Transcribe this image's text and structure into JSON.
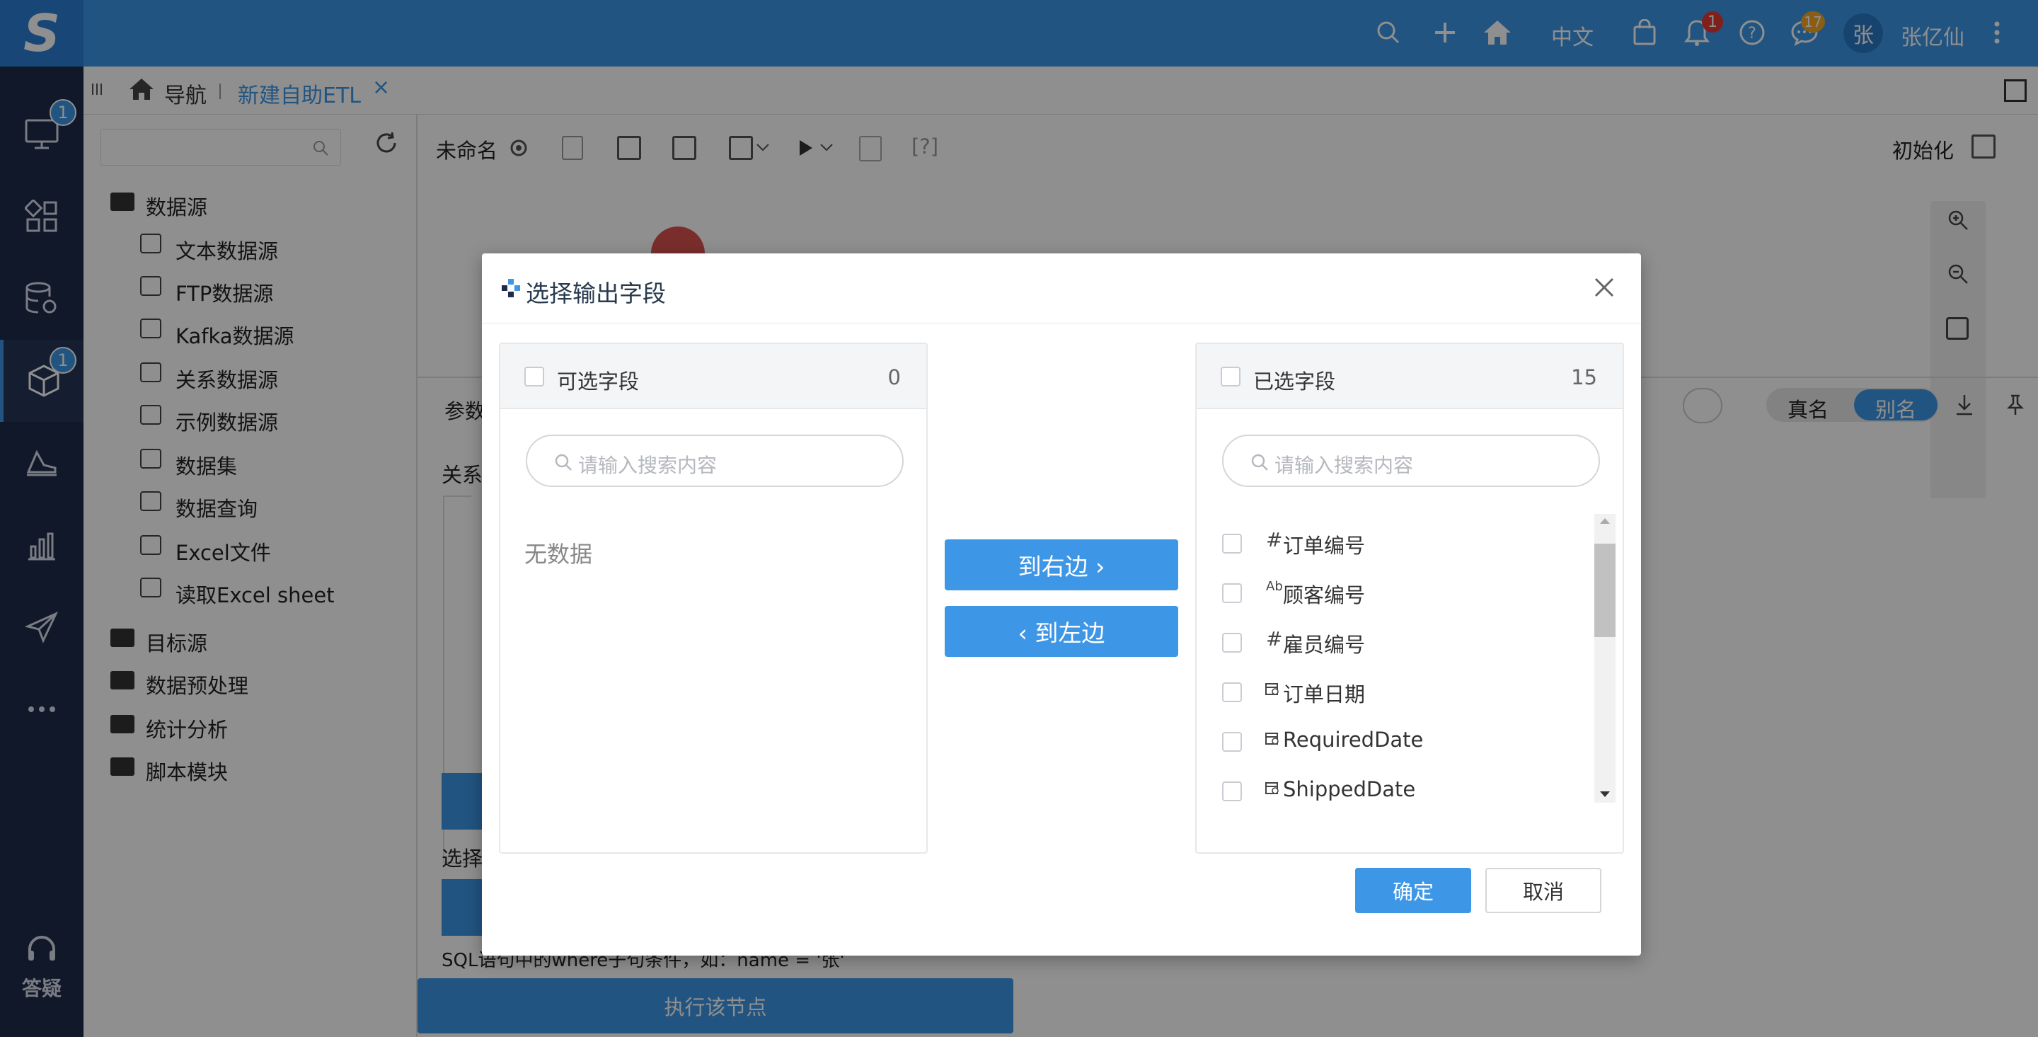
{
  "topbar": {
    "language": "中文",
    "notification_count": "1",
    "message_count": "17",
    "avatar_initial": "张",
    "user_name": "张亿仙"
  },
  "rail": {
    "badge_1": "1",
    "badge_2": "1",
    "help_label": "答疑"
  },
  "tabs": {
    "nav_label": "导航",
    "active_tab": "新建自助ETL",
    "close_symbol": "×"
  },
  "toolbar": {
    "unnamed": "未命名",
    "help": "[?]",
    "init": "初始化"
  },
  "tree": {
    "datasource": "数据源",
    "items": [
      "文本数据源",
      "FTP数据源",
      "Kafka数据源",
      "关系数据源",
      "示例数据源",
      "数据集",
      "数据查询",
      "Excel文件",
      "读取Excel sheet"
    ],
    "folders": [
      "目标源",
      "数据预处理",
      "统计分析",
      "脚本模块"
    ]
  },
  "background": {
    "params_label": "参数",
    "relation_label": "关系",
    "select_label": "选择",
    "real_name": "真名",
    "alias": "别名",
    "sql_hint": "SQL语句中的where子句条件，如：name = '张'",
    "execute_node": "执行该节点"
  },
  "dialog": {
    "title": "选择输出字段",
    "left_panel": {
      "title": "可选字段",
      "count": "0",
      "search_placeholder": "请输入搜索内容",
      "empty_text": "无数据"
    },
    "right_panel": {
      "title": "已选字段",
      "count": "15",
      "search_placeholder": "请输入搜索内容",
      "fields": [
        {
          "type": "#",
          "label": "订单编号"
        },
        {
          "type": "Ab",
          "label": "顾客编号"
        },
        {
          "type": "#",
          "label": "雇员编号"
        },
        {
          "type": "date",
          "label": "订单日期"
        },
        {
          "type": "date",
          "label": "RequiredDate"
        },
        {
          "type": "date",
          "label": "ShippedDate"
        }
      ]
    },
    "to_right": "到右边 ›",
    "to_left": "‹ 到左边",
    "ok": "确定",
    "cancel": "取消"
  }
}
